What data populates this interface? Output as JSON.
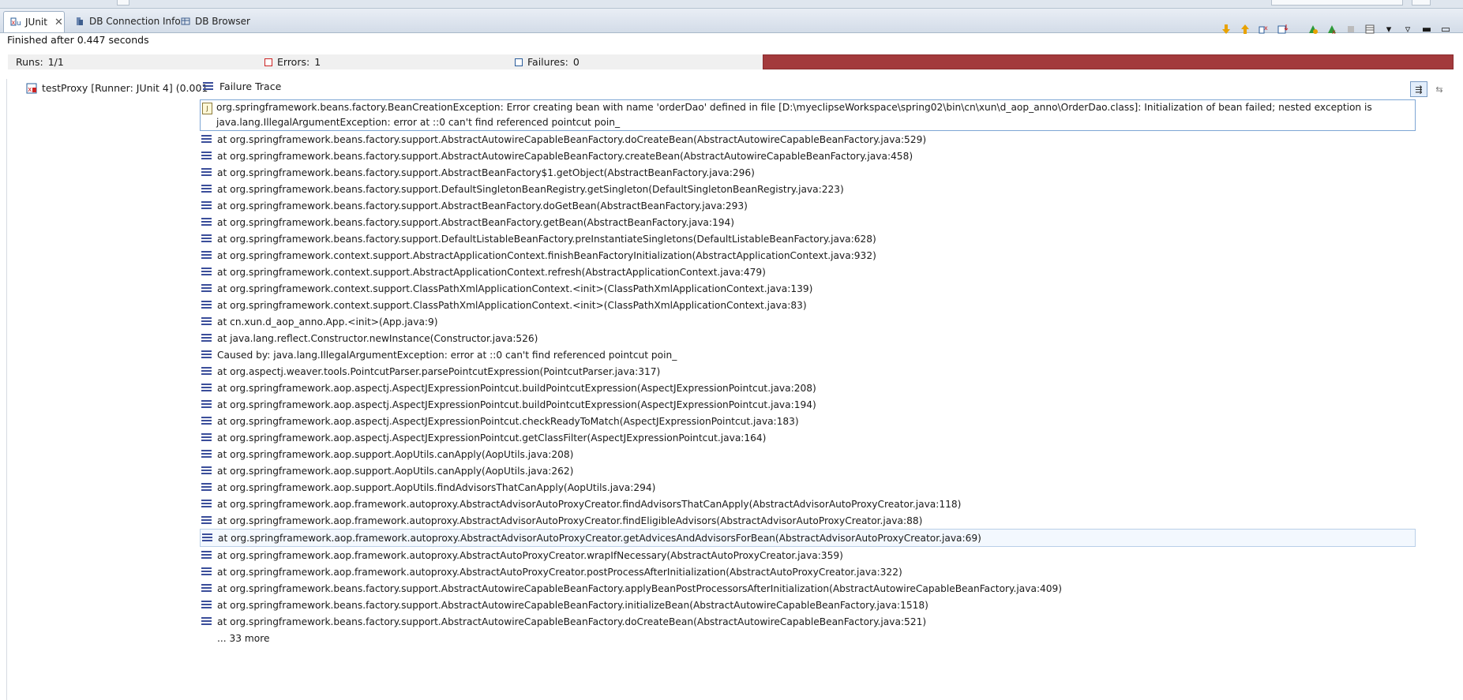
{
  "tabs": [
    {
      "label": "JUnit",
      "icon": "junit-icon",
      "active": true
    },
    {
      "label": "DB Connection Info",
      "icon": "db-connection-icon",
      "active": false
    },
    {
      "label": "DB Browser",
      "icon": "db-browser-icon",
      "active": false
    }
  ],
  "status": "Finished after 0.447 seconds",
  "counters": {
    "runs_label": "Runs:",
    "runs_value": "1/1",
    "errors_label": "Errors:",
    "errors_value": "1",
    "failures_label": "Failures:",
    "failures_value": "0"
  },
  "colors": {
    "progress_error": "#a33a3c",
    "accent": "#3b4e9a"
  },
  "tree": {
    "test_label": "testProxy [Runner: JUnit 4] (0.001"
  },
  "failure_trace": {
    "header": "Failure Trace",
    "first_line": "org.springframework.beans.factory.BeanCreationException: Error creating bean with name 'orderDao' defined in file [D:\\myeclipseWorkspace\\spring02\\bin\\cn\\xun\\d_aop_anno\\OrderDao.class]: Initialization of bean failed; nested exception is java.lang.IllegalArgumentException: error at ::0 can't find referenced pointcut poin_",
    "lines": [
      "at org.springframework.beans.factory.support.AbstractAutowireCapableBeanFactory.doCreateBean(AbstractAutowireCapableBeanFactory.java:529)",
      "at org.springframework.beans.factory.support.AbstractAutowireCapableBeanFactory.createBean(AbstractAutowireCapableBeanFactory.java:458)",
      "at org.springframework.beans.factory.support.AbstractBeanFactory$1.getObject(AbstractBeanFactory.java:296)",
      "at org.springframework.beans.factory.support.DefaultSingletonBeanRegistry.getSingleton(DefaultSingletonBeanRegistry.java:223)",
      "at org.springframework.beans.factory.support.AbstractBeanFactory.doGetBean(AbstractBeanFactory.java:293)",
      "at org.springframework.beans.factory.support.AbstractBeanFactory.getBean(AbstractBeanFactory.java:194)",
      "at org.springframework.beans.factory.support.DefaultListableBeanFactory.preInstantiateSingletons(DefaultListableBeanFactory.java:628)",
      "at org.springframework.context.support.AbstractApplicationContext.finishBeanFactoryInitialization(AbstractApplicationContext.java:932)",
      "at org.springframework.context.support.AbstractApplicationContext.refresh(AbstractApplicationContext.java:479)",
      "at org.springframework.context.support.ClassPathXmlApplicationContext.<init>(ClassPathXmlApplicationContext.java:139)",
      "at org.springframework.context.support.ClassPathXmlApplicationContext.<init>(ClassPathXmlApplicationContext.java:83)",
      "at cn.xun.d_aop_anno.App.<init>(App.java:9)",
      "at java.lang.reflect.Constructor.newInstance(Constructor.java:526)",
      "Caused by: java.lang.IllegalArgumentException: error at ::0 can't find referenced pointcut poin_",
      "at org.aspectj.weaver.tools.PointcutParser.parsePointcutExpression(PointcutParser.java:317)",
      "at org.springframework.aop.aspectj.AspectJExpressionPointcut.buildPointcutExpression(AspectJExpressionPointcut.java:208)",
      "at org.springframework.aop.aspectj.AspectJExpressionPointcut.buildPointcutExpression(AspectJExpressionPointcut.java:194)",
      "at org.springframework.aop.aspectj.AspectJExpressionPointcut.checkReadyToMatch(AspectJExpressionPointcut.java:183)",
      "at org.springframework.aop.aspectj.AspectJExpressionPointcut.getClassFilter(AspectJExpressionPointcut.java:164)",
      "at org.springframework.aop.support.AopUtils.canApply(AopUtils.java:208)",
      "at org.springframework.aop.support.AopUtils.canApply(AopUtils.java:262)",
      "at org.springframework.aop.support.AopUtils.findAdvisorsThatCanApply(AopUtils.java:294)",
      "at org.springframework.aop.framework.autoproxy.AbstractAdvisorAutoProxyCreator.findAdvisorsThatCanApply(AbstractAdvisorAutoProxyCreator.java:118)",
      "at org.springframework.aop.framework.autoproxy.AbstractAdvisorAutoProxyCreator.findEligibleAdvisors(AbstractAdvisorAutoProxyCreator.java:88)",
      "at org.springframework.aop.framework.autoproxy.AbstractAdvisorAutoProxyCreator.getAdvicesAndAdvisorsForBean(AbstractAdvisorAutoProxyCreator.java:69)",
      "at org.springframework.aop.framework.autoproxy.AbstractAutoProxyCreator.wrapIfNecessary(AbstractAutoProxyCreator.java:359)",
      "at org.springframework.aop.framework.autoproxy.AbstractAutoProxyCreator.postProcessAfterInitialization(AbstractAutoProxyCreator.java:322)",
      "at org.springframework.beans.factory.support.AbstractAutowireCapableBeanFactory.applyBeanPostProcessorsAfterInitialization(AbstractAutowireCapableBeanFactory.java:409)",
      "at org.springframework.beans.factory.support.AbstractAutowireCapableBeanFactory.initializeBean(AbstractAutowireCapableBeanFactory.java:1518)",
      "at org.springframework.beans.factory.support.AbstractAutowireCapableBeanFactory.doCreateBean(AbstractAutowireCapableBeanFactory.java:521)"
    ],
    "selected_index": 24,
    "more": "... 33 more"
  }
}
